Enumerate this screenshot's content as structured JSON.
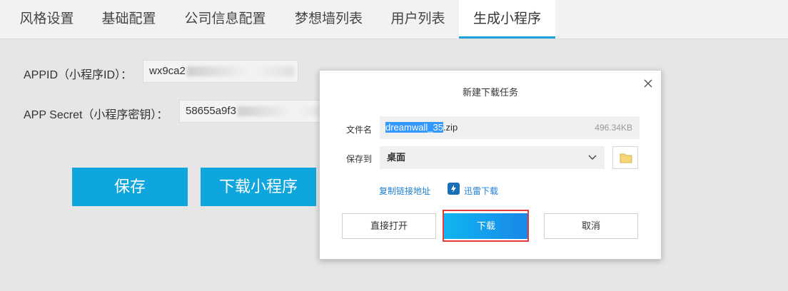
{
  "tabs": [
    "风格设置",
    "基础配置",
    "公司信息配置",
    "梦想墙列表",
    "用户列表",
    "生成小程序"
  ],
  "form": {
    "appid_label": "APPID（小程序ID）：",
    "appid_value": "wx9ca2",
    "secret_label": "APP Secret（小程序密钥）：",
    "secret_value": "58655a9f3",
    "save_label": "保存",
    "download_label": "下载小程序"
  },
  "dialog": {
    "title": "新建下载任务",
    "filename_label": "文件名",
    "filename_selected": "dreamwall_35",
    "filename_ext": ".zip",
    "filesize": "496.34KB",
    "saveto_label": "保存到",
    "saveto_value": "桌面",
    "copy_link": "复制链接地址",
    "thunder": "迅雷下载",
    "open_direct": "直接打开",
    "download": "下载",
    "cancel": "取消"
  },
  "colors": {
    "accent": "#0fa6de",
    "tab_active_underline": "#1fa0dc",
    "highlight_frame": "#e23b3b",
    "link": "#1f7fd4"
  },
  "icons": [
    "close-icon",
    "chevron-down-icon",
    "folder-icon",
    "thunder-icon"
  ]
}
